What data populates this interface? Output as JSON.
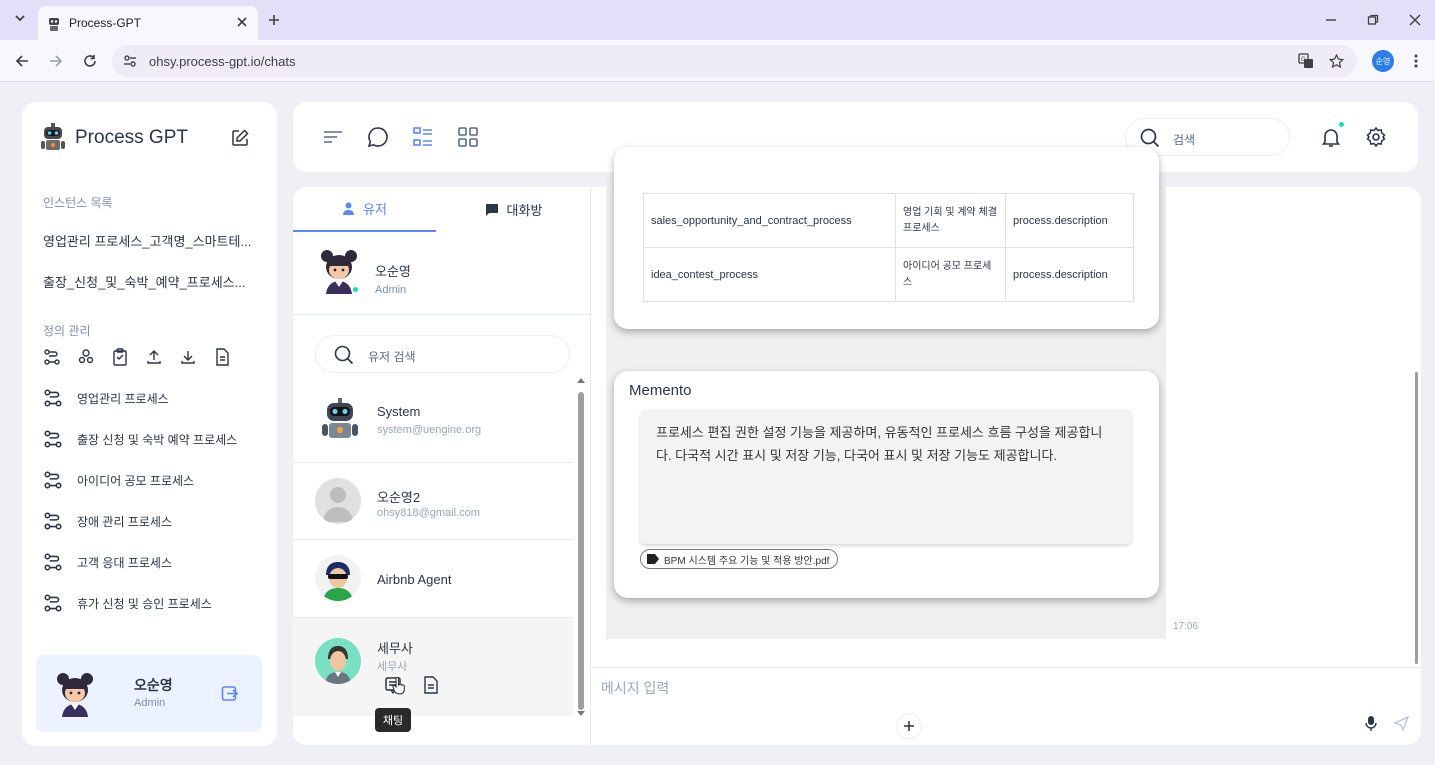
{
  "browser": {
    "tab_title": "Process-GPT",
    "url": "ohsy.process-gpt.io/chats",
    "profile_initials": "순영"
  },
  "sidebar": {
    "app_name": "Process GPT",
    "instances_label": "인스턴스 목록",
    "instances": [
      "영업관리 프로세스_고객명_스마트테...",
      "출장_신청_및_숙박_예약_프로세스..."
    ],
    "definitions_label": "정의 관리",
    "processes": [
      "영업관리 프로세스",
      "출장 신청 및 숙박 예약 프로세스",
      "아이디어 공모 프로세스",
      "장애 관리 프로세스",
      "고객 응대 프로세스",
      "휴가 신청 및 승인 프로세스"
    ],
    "user": {
      "name": "오순영",
      "role": "Admin"
    }
  },
  "topbar": {
    "search_placeholder": "검색"
  },
  "user_panel": {
    "tabs": {
      "users": "유저",
      "rooms": "대화방"
    },
    "current_user": {
      "name": "오순영",
      "role": "Admin"
    },
    "search_placeholder": "유저 검색",
    "list": [
      {
        "name": "System",
        "email": "system@uengine.org"
      },
      {
        "name": "오순영2",
        "email": "ohsy818@gmail.com"
      },
      {
        "name": "Airbnb Agent",
        "email": ""
      },
      {
        "name": "세무사",
        "email": "세무사"
      }
    ],
    "tooltip": "채팅"
  },
  "chat": {
    "table_rows": [
      [
        "sales_opportunity_and_contract_process",
        "영업 기회 및 계약 체결 프로세스",
        "process.description"
      ],
      [
        "idea_contest_process",
        "아이디어 공모 프로세스",
        "process.description"
      ]
    ],
    "memento": {
      "title": "Memento",
      "text": "프로세스 편집 권한 설정 기능을 제공하며, 유동적인 프로세스 흐름 구성을 제공합니다. 다국적 시간 표시 및 저장 기능, 다국어 표시 및 저장 기능도 제공합니다.",
      "attachment": "BPM 시스템 주요 기능 및 적용 방안.pdf"
    },
    "timestamp": "17:06",
    "input_placeholder": "메시지 입력"
  },
  "colors": {
    "accent": "#5d87ff",
    "online": "#13deb9"
  }
}
